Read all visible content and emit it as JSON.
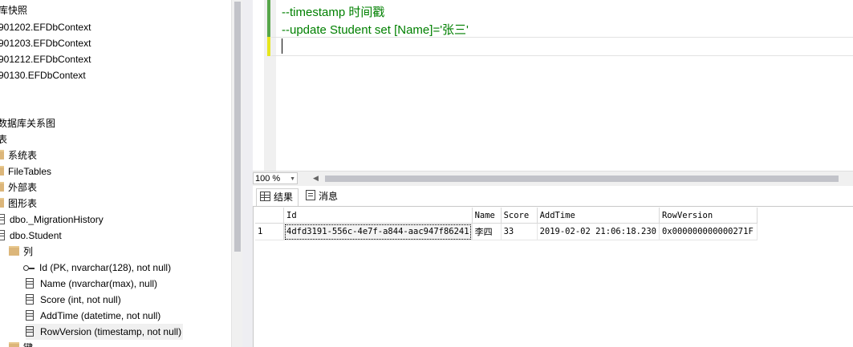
{
  "explorer": {
    "items": [
      {
        "label": "库快照"
      },
      {
        "label": "901202.EFDbContext"
      },
      {
        "label": "901203.EFDbContext"
      },
      {
        "label": "901212.EFDbContext"
      },
      {
        "label": "90130.EFDbContext"
      },
      {
        "label": "数据库关系图"
      },
      {
        "label": "表"
      },
      {
        "label": "系统表"
      },
      {
        "label": "FileTables"
      },
      {
        "label": "外部表"
      },
      {
        "label": "图形表"
      },
      {
        "label": "dbo._MigrationHistory"
      },
      {
        "label": "dbo.Student"
      },
      {
        "label": "列"
      },
      {
        "label": "Id (PK, nvarchar(128), not null)"
      },
      {
        "label": "Name (nvarchar(max), null)"
      },
      {
        "label": "Score (int, not null)"
      },
      {
        "label": "AddTime (datetime, not null)"
      },
      {
        "label": "RowVersion (timestamp, not null)"
      },
      {
        "label": "键"
      }
    ]
  },
  "editor": {
    "lines": [
      "--timestamp  时间戳",
      "--update Student set [Name]='张三'"
    ]
  },
  "zoom": {
    "value": "100 %"
  },
  "results": {
    "tabs": [
      {
        "label": "结果"
      },
      {
        "label": "消息"
      }
    ],
    "columns": [
      "",
      "Id",
      "Name",
      "Score",
      "AddTime",
      "RowVersion"
    ],
    "rows": [
      [
        "1",
        "4dfd3191-556c-4e7f-a844-aac947f86241",
        "李四",
        "33",
        "2019-02-02 21:06:18.230",
        "0x000000000000271F"
      ]
    ]
  },
  "colors": {
    "comment": "#008000",
    "folder": "#dcb67a",
    "change_saved": "#57a64a",
    "change_unsaved": "#e6e61e"
  }
}
